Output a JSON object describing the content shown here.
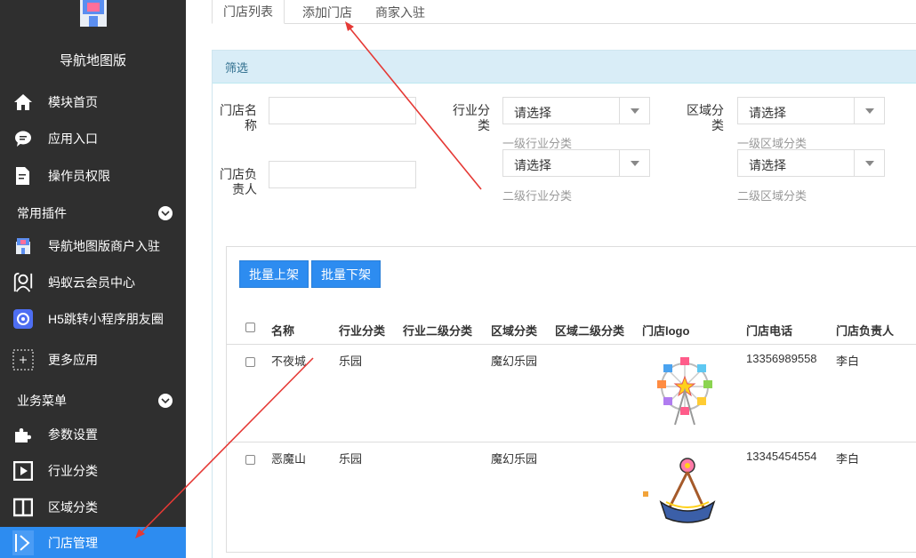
{
  "sidebar": {
    "app_title": "导航地图版",
    "items": [
      {
        "label": "模块首页",
        "icon": "home-icon"
      },
      {
        "label": "应用入口",
        "icon": "chat-icon"
      },
      {
        "label": "操作员权限",
        "icon": "document-edit-icon"
      }
    ],
    "section_plugins": "常用插件",
    "plugins": [
      {
        "label": "导航地图版商户入驻",
        "icon": "shop-icon"
      },
      {
        "label": "蚂蚁云会员中心",
        "icon": "member-icon"
      },
      {
        "label": "H5跳转小程序朋友圈",
        "icon": "jump-icon"
      },
      {
        "label": "更多应用",
        "icon": "plus-icon"
      }
    ],
    "section_business": "业务菜单",
    "business": [
      {
        "label": "参数设置",
        "icon": "puzzle-icon"
      },
      {
        "label": "行业分类",
        "icon": "play-icon"
      },
      {
        "label": "区域分类",
        "icon": "columns-icon"
      },
      {
        "label": "门店管理",
        "icon": "store-icon"
      }
    ]
  },
  "tabs": [
    "门店列表",
    "添加门店",
    "商家入驻"
  ],
  "filter": {
    "title": "筛选",
    "store_name_label": "门店名称",
    "manager_label": "门店负责人",
    "industry_label": "行业分类",
    "region_label": "区域分类",
    "select_placeholder": "请选择",
    "industry_l1_hint": "一级行业分类",
    "industry_l2_hint": "二级行业分类",
    "region_l1_hint": "一级区域分类",
    "region_l2_hint": "二级区域分类"
  },
  "actions": {
    "batch_on": "批量上架",
    "batch_off": "批量下架"
  },
  "table": {
    "headers": [
      "名称",
      "行业分类",
      "行业二级分类",
      "区域分类",
      "区域二级分类",
      "门店logo",
      "门店电话",
      "门店负责人"
    ],
    "rows": [
      {
        "name": "不夜城",
        "industry": "乐园",
        "industry2": "",
        "region": "魔幻乐园",
        "region2": "",
        "logo": "ferris-wheel-icon",
        "phone": "13356989558",
        "manager": "李白"
      },
      {
        "name": "恶魔山",
        "industry": "乐园",
        "industry2": "",
        "region": "魔幻乐园",
        "region2": "",
        "logo": "pirate-ship-icon",
        "phone": "13345454554",
        "manager": "李白"
      }
    ]
  },
  "colors": {
    "sidebar_bg": "#2f2f2f",
    "active": "#2d8cf0",
    "panel_head": "#d9edf7",
    "annotation": "#e53935"
  }
}
